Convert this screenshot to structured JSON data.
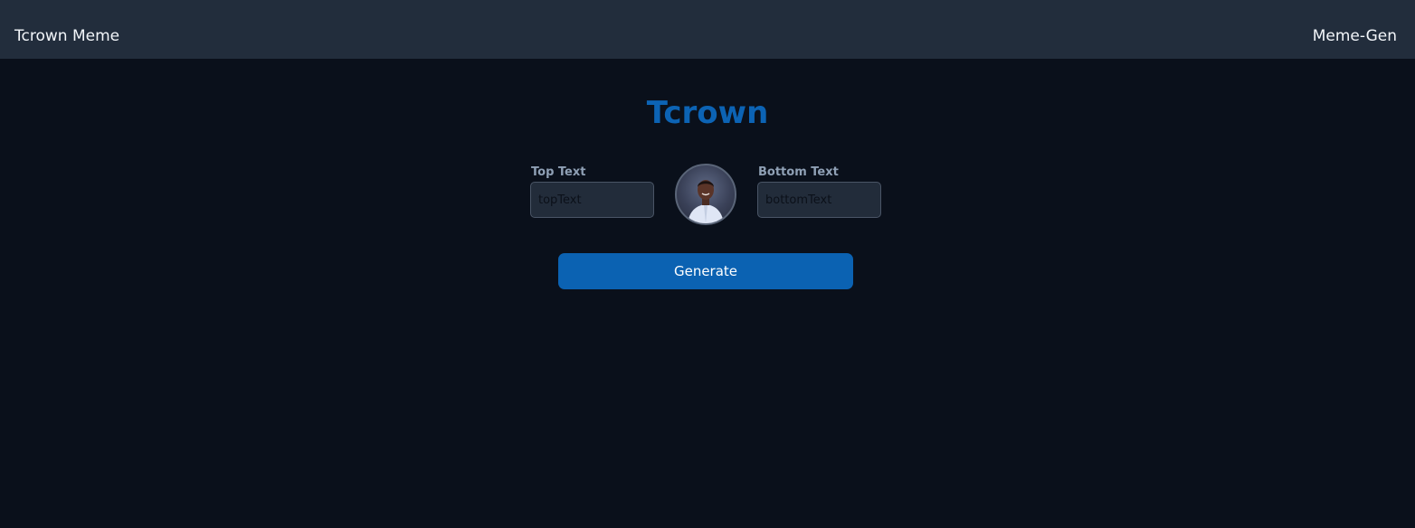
{
  "navbar": {
    "brand": "Tcrown Meme",
    "nav_link": "Meme-Gen"
  },
  "main": {
    "title": "Tcrown",
    "top_text": {
      "label": "Top Text",
      "placeholder": "topText",
      "value": ""
    },
    "bottom_text": {
      "label": "Bottom Text",
      "placeholder": "bottomText",
      "value": ""
    },
    "avatar_icon": "person-photo",
    "generate_label": "Generate"
  },
  "colors": {
    "page_background": "#0a101b",
    "navbar_background": "#222d3c",
    "title_accent": "#0c63b4",
    "button_background": "#0b62b2",
    "label_color": "#8fa0b5"
  }
}
